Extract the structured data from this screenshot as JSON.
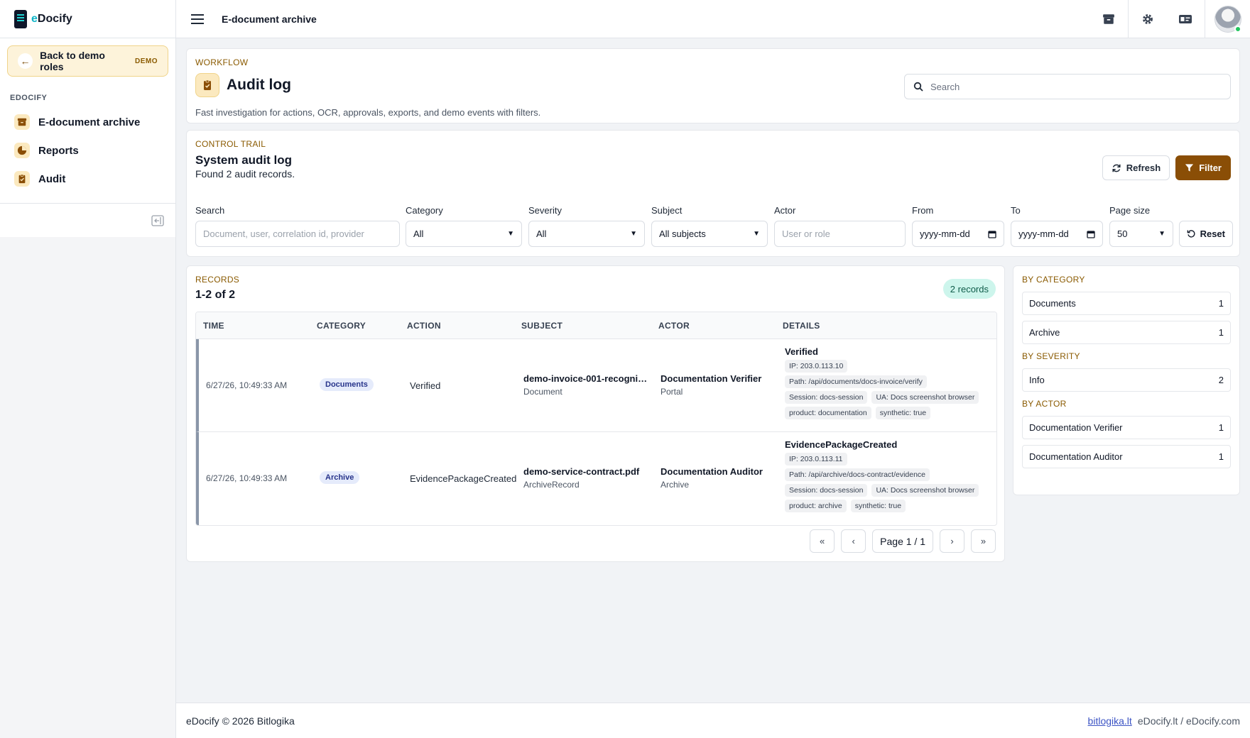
{
  "brand": {
    "prefix": "e",
    "name": "Docify"
  },
  "sidebar": {
    "back_label": "Back to demo roles",
    "demo_badge": "DEMO",
    "section_heading": "EDOCIFY",
    "items": [
      {
        "label": "E-document archive",
        "icon": "archive-box-icon"
      },
      {
        "label": "Reports",
        "icon": "pie-chart-icon"
      },
      {
        "label": "Audit",
        "icon": "clipboard-check-icon"
      }
    ]
  },
  "topbar": {
    "title": "E-document archive",
    "actions": [
      "archive-box-icon",
      "gear-icon",
      "id-card-icon",
      "avatar"
    ]
  },
  "header": {
    "eyebrow": "WORKFLOW",
    "title": "Audit log",
    "description": "Fast investigation for actions, OCR, approvals, exports, and demo events with filters.",
    "search_placeholder": "Search"
  },
  "control": {
    "eyebrow": "CONTROL TRAIL",
    "title": "System audit log",
    "subtitle": "Found 2 audit records.",
    "refresh_label": "Refresh",
    "filter_label": "Filter",
    "filters": {
      "search": {
        "label": "Search",
        "placeholder": "Document, user, correlation id, provider"
      },
      "category": {
        "label": "Category",
        "value": "All"
      },
      "severity": {
        "label": "Severity",
        "value": "All"
      },
      "subject": {
        "label": "Subject",
        "value": "All subjects"
      },
      "actor": {
        "label": "Actor",
        "placeholder": "User or role"
      },
      "from": {
        "label": "From",
        "placeholder": "yyyy-mm-dd"
      },
      "to": {
        "label": "To",
        "placeholder": "yyyy-mm-dd"
      },
      "page_size": {
        "label": "Page size",
        "value": "50"
      },
      "reset_label": "Reset"
    }
  },
  "records": {
    "eyebrow": "RECORDS",
    "count": "1-2 of 2",
    "badge": "2 records",
    "columns": [
      "TIME",
      "CATEGORY",
      "ACTION",
      "SUBJECT",
      "ACTOR",
      "DETAILS"
    ],
    "rows": [
      {
        "time": "6/27/26, 10:49:33 AM",
        "category": "Documents",
        "action": "Verified",
        "subject": "demo-invoice-001-recognize...",
        "subject_type": "Document",
        "actor": "Documentation Verifier",
        "actor_type": "Portal",
        "details_title": "Verified",
        "tags": [
          "IP: 203.0.113.10",
          "Path: /api/documents/docs-invoice/verify",
          "Session: docs-session",
          "UA: Docs screenshot browser",
          "product: documentation",
          "synthetic: true"
        ]
      },
      {
        "time": "6/27/26, 10:49:33 AM",
        "category": "Archive",
        "action": "EvidencePackageCreated",
        "subject": "demo-service-contract.pdf",
        "subject_type": "ArchiveRecord",
        "actor": "Documentation Auditor",
        "actor_type": "Archive",
        "details_title": "EvidencePackageCreated",
        "tags": [
          "IP: 203.0.113.11",
          "Path: /api/archive/docs-contract/evidence",
          "Session: docs-session",
          "UA: Docs screenshot browser",
          "product: archive",
          "synthetic: true"
        ]
      }
    ],
    "pager_label": "Page 1 / 1"
  },
  "stats": {
    "by_category": {
      "heading": "BY CATEGORY",
      "items": [
        {
          "label": "Documents",
          "count": "1"
        },
        {
          "label": "Archive",
          "count": "1"
        }
      ]
    },
    "by_severity": {
      "heading": "BY SEVERITY",
      "items": [
        {
          "label": "Info",
          "count": "2"
        }
      ]
    },
    "by_actor": {
      "heading": "BY ACTOR",
      "items": [
        {
          "label": "Documentation Verifier",
          "count": "1"
        },
        {
          "label": "Documentation Auditor",
          "count": "1"
        }
      ]
    }
  },
  "footer": {
    "copyright": "eDocify © 2026 Bitlogika",
    "link": "bitlogika.lt",
    "domains": "eDocify.lt / eDocify.com"
  },
  "colors": {
    "accent": "#8a4e06",
    "accent_soft": "#fbe9bf",
    "badge_teal": "#cdf5ec",
    "category_pill": "#e5ebfb"
  }
}
